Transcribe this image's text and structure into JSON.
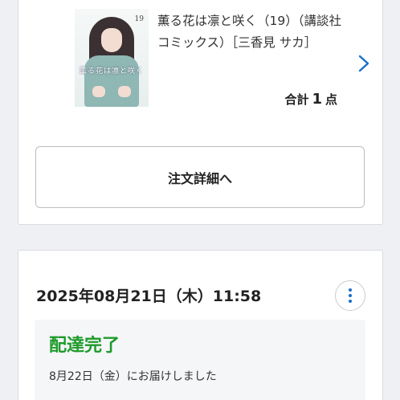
{
  "product": {
    "title": "薫る花は凛と咲く（19）（講談社コミックス）［三香見 サカ］",
    "cover_volume": "19",
    "cover_title": "薫る花は凛と咲く"
  },
  "summary": {
    "total_label": "合計",
    "total_count": "1",
    "total_unit": "点"
  },
  "actions": {
    "order_detail_label": "注文詳細へ"
  },
  "order": {
    "datetime": "2025年08月21日（木）11:58",
    "status": "配達完了",
    "delivery_note": "8月22日（金）にお届けしました"
  },
  "colors": {
    "accent": "#1a6ec9",
    "status_green": "#1e9a2a",
    "background": "#eef0f3"
  },
  "icons": [
    "chevron-right-icon",
    "more-vertical-icon"
  ]
}
